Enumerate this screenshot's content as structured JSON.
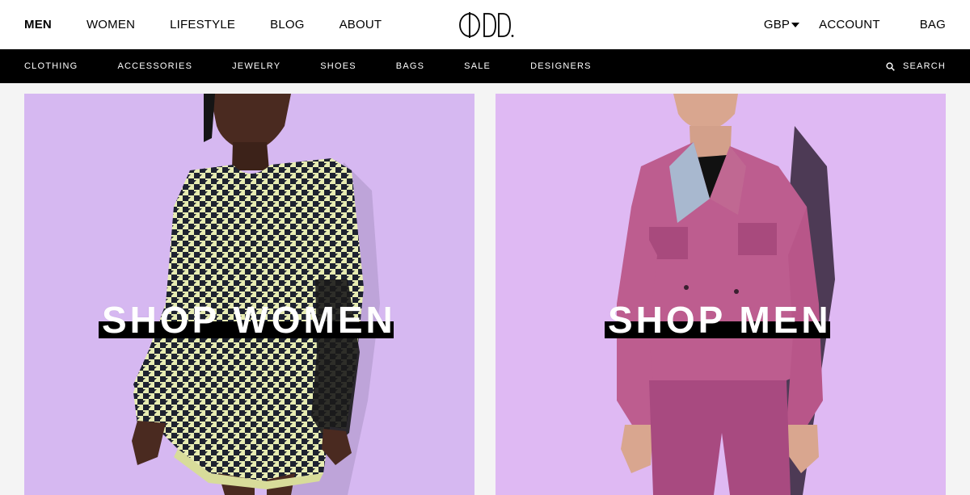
{
  "brand": {
    "logo_text": "ODD."
  },
  "top_nav": {
    "left": [
      "MEN",
      "WOMEN",
      "LIFESTYLE",
      "BLOG",
      "ABOUT"
    ],
    "active": "MEN",
    "currency": "GBP",
    "account": "ACCOUNT",
    "bag": "BAG"
  },
  "category_bar": {
    "items": [
      "CLOTHING",
      "ACCESSORIES",
      "JEWELRY",
      "SHOES",
      "BAGS",
      "SALE",
      "DESIGNERS"
    ],
    "search_label": "SEARCH"
  },
  "hero": {
    "women": {
      "cta": "SHOP WOMEN",
      "bg_color": "#d6b8f1"
    },
    "men": {
      "cta": "SHOP MEN",
      "bg_color": "#dfb9f3"
    }
  },
  "colors": {
    "header_bg": "#ffffff",
    "category_bar_bg": "#000000",
    "page_bg": "#f4f4f4"
  },
  "icons": {
    "search": "search-icon",
    "currency_caret": "caret-down-icon"
  }
}
